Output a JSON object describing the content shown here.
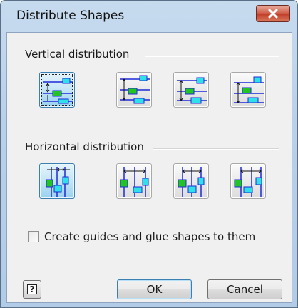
{
  "window": {
    "title": "Distribute Shapes"
  },
  "vertical": {
    "label": "Vertical distribution",
    "options": [
      {
        "name": "distribute-vertical-space",
        "selected": true
      },
      {
        "name": "distribute-vertical-top",
        "selected": false
      },
      {
        "name": "distribute-vertical-middle",
        "selected": false
      },
      {
        "name": "distribute-vertical-bottom",
        "selected": false
      }
    ]
  },
  "horizontal": {
    "label": "Horizontal distribution",
    "options": [
      {
        "name": "distribute-horizontal-space",
        "selected": true
      },
      {
        "name": "distribute-horizontal-left",
        "selected": false
      },
      {
        "name": "distribute-horizontal-center",
        "selected": false
      },
      {
        "name": "distribute-horizontal-right",
        "selected": false
      }
    ]
  },
  "guides_checkbox": {
    "label": "Create guides and glue shapes to them",
    "checked": false
  },
  "buttons": {
    "help_glyph": "?",
    "ok": "OK",
    "cancel": "Cancel"
  },
  "colors": {
    "shape_green": "#22c422",
    "shape_cyan": "#2fe0e8",
    "guide_blue": "#1f2ad8",
    "accent": "#3c7fb1"
  }
}
